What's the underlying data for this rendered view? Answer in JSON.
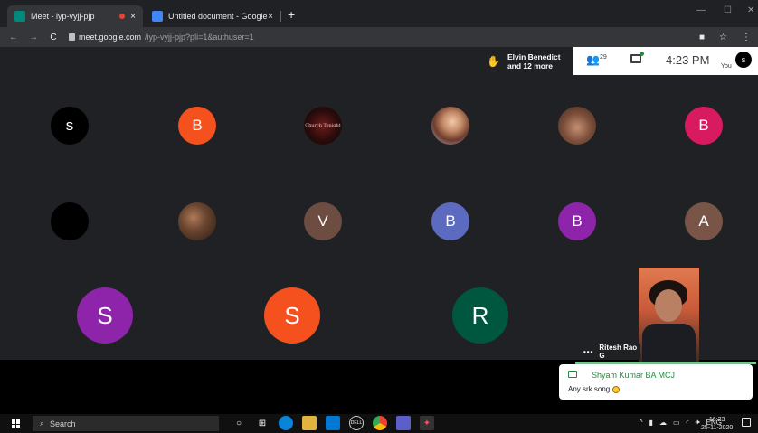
{
  "browser": {
    "tabs": [
      {
        "title": "Meet - iyp-vyjj-pjp",
        "close": "×"
      },
      {
        "title": "Untitled document - Google Doc",
        "close": "×"
      }
    ],
    "new_tab": "+",
    "window": {
      "minimize": "—",
      "maximize": "☐",
      "close": "✕"
    },
    "url_host": "meet.google.com",
    "url_path": "/iyp-vyjj-pjp?pli=1&authuser=1",
    "nav": {
      "back": "←",
      "forward": "→",
      "reload": "C"
    },
    "toolbar": {
      "ext": "■",
      "star": "☆",
      "menu": "⋮"
    }
  },
  "meet": {
    "presenting": {
      "line1": "Elvin Benedict",
      "line2": "and 12 more"
    },
    "participants_count": "29",
    "time": "4:23 PM",
    "you_label": "You",
    "self_initial": "s"
  },
  "grid": {
    "row1": [
      {
        "initial": "s",
        "color": "#000000",
        "kind": "letter"
      },
      {
        "initial": "B",
        "color": "#f4511e",
        "kind": "letter"
      },
      {
        "caption": "Church Tonight",
        "kind": "photo-party"
      },
      {
        "kind": "photo-woman"
      },
      {
        "kind": "photo-man"
      },
      {
        "initial": "B",
        "color": "#d81b60",
        "kind": "letter"
      }
    ],
    "row2": [
      {
        "initial": "",
        "color": "#000000",
        "kind": "letter"
      },
      {
        "kind": "photo-dark"
      },
      {
        "initial": "V",
        "color": "#6d4c41",
        "kind": "letter"
      },
      {
        "initial": "B",
        "color": "#5c6bc0",
        "kind": "letter"
      },
      {
        "initial": "B",
        "color": "#8e24aa",
        "kind": "letter"
      },
      {
        "initial": "A",
        "color": "#795548",
        "kind": "letter"
      }
    ],
    "row3": [
      {
        "initial": "S",
        "color": "#8e24aa"
      },
      {
        "initial": "S",
        "color": "#f4511e"
      },
      {
        "initial": "R",
        "color": "#00573f"
      }
    ]
  },
  "preview": {
    "name": "Ritesh Rao G",
    "more": "•••"
  },
  "chat_popup": {
    "sender": "Shyam Kumar BA MCJ",
    "message": "Any srk song"
  },
  "taskbar": {
    "search_placeholder": "Search",
    "search_icon": "⌕",
    "tray": {
      "chevron": "^",
      "lang": "ENG",
      "volume": "🕪"
    },
    "time": "16:23",
    "date": "25-11-2020"
  }
}
